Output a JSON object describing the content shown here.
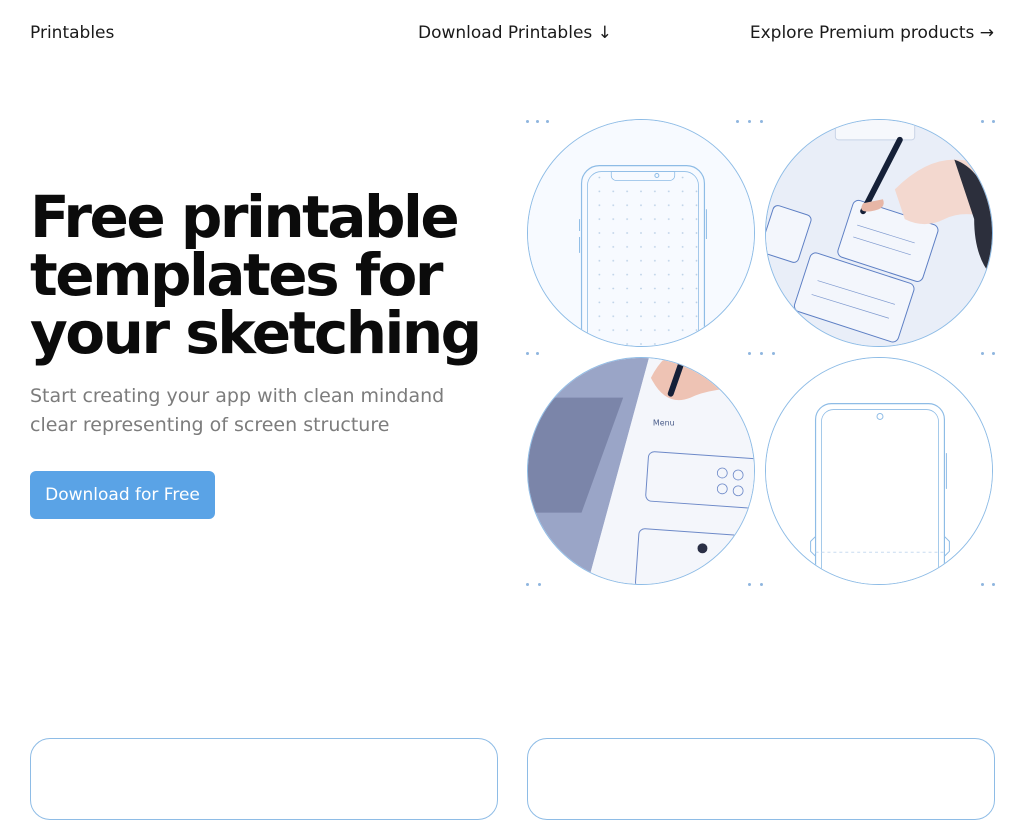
{
  "nav": {
    "brand": "Printables",
    "download": "Download Printables ↓",
    "explore": "Explore Premium products →"
  },
  "hero": {
    "title_lines": [
      "Free printable",
      "templates for",
      "your sketching"
    ],
    "subtitle": "Start creating your app with clean mindand clear representing of screen structure",
    "cta": "Download for Free"
  },
  "gallery": {
    "items": [
      {
        "icon": "phone-template-dotted-grid"
      },
      {
        "icon": "hand-sketching-wireframes"
      },
      {
        "icon": "hand-drawing-on-paper-with-laptop"
      },
      {
        "icon": "phone-template-blank"
      }
    ]
  },
  "colors": {
    "accent": "#5aa3e6",
    "outline": "#8ebce6",
    "subtitle": "#7c7c7c"
  }
}
